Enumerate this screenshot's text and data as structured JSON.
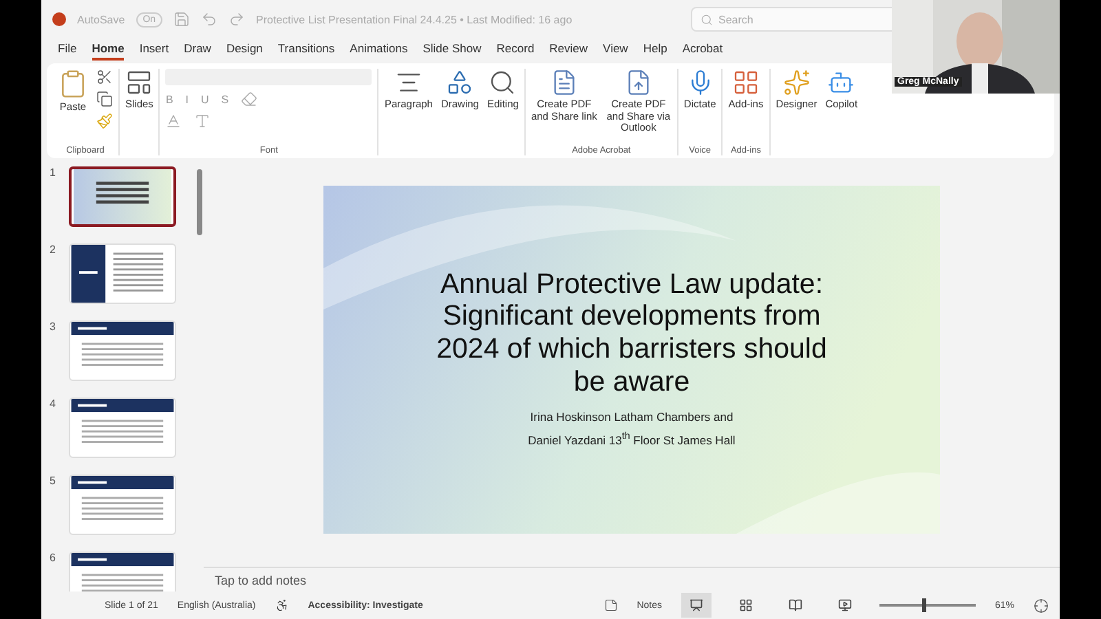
{
  "title_bar": {
    "autosave_label": "AutoSave",
    "autosave_toggle": "On",
    "document_title": "Protective List Presentation Final 24.4.25 • Last Modified: 16 ago",
    "search": {
      "placeholder": "Search"
    }
  },
  "tabs": [
    {
      "label": "File",
      "selected": false
    },
    {
      "label": "Home",
      "selected": true
    },
    {
      "label": "Insert",
      "selected": false
    },
    {
      "label": "Draw",
      "selected": false
    },
    {
      "label": "Design",
      "selected": false
    },
    {
      "label": "Transitions",
      "selected": false
    },
    {
      "label": "Animations",
      "selected": false
    },
    {
      "label": "Slide Show",
      "selected": false
    },
    {
      "label": "Record",
      "selected": false
    },
    {
      "label": "Review",
      "selected": false
    },
    {
      "label": "View",
      "selected": false
    },
    {
      "label": "Help",
      "selected": false
    },
    {
      "label": "Acrobat",
      "selected": false
    }
  ],
  "ribbon": {
    "clipboard": {
      "paste": "Paste",
      "group": "Clipboard"
    },
    "slides": {
      "label": "Slides"
    },
    "font": {
      "format_buttons": [
        "B",
        "I",
        "U",
        "S"
      ],
      "group": "Font"
    },
    "paragraph": "Paragraph",
    "drawing": "Drawing",
    "editing": "Editing",
    "acrobat": {
      "buttons": [
        "Create PDF and Share link",
        "Create PDF and Share via Outlook"
      ],
      "group": "Adobe Acrobat"
    },
    "voice": {
      "button": "Dictate",
      "group": "Voice"
    },
    "addins": {
      "button": "Add-ins",
      "group": "Add-ins"
    },
    "designer": "Designer",
    "copilot": "Copilot"
  },
  "video": {
    "name": "Greg McNally"
  },
  "slides": [
    {
      "number": "1",
      "kind": "title",
      "selected": true
    },
    {
      "number": "2",
      "kind": "split",
      "selected": false
    },
    {
      "number": "3",
      "kind": "banner",
      "selected": false
    },
    {
      "number": "4",
      "kind": "banner",
      "selected": false
    },
    {
      "number": "5",
      "kind": "banner",
      "selected": false
    },
    {
      "number": "6",
      "kind": "banner",
      "selected": false
    }
  ],
  "slide": {
    "title": "Annual Protective Law update: Significant developments from 2024 of which barristers should be aware",
    "subtitle": [
      "Irina Hoskinson Latham Chambers and",
      "Daniel Yazdani 13$^{th}$ Floor St James Hall"
    ]
  },
  "notes": {
    "placeholder": "Tap to add notes"
  },
  "status_bar": {
    "slide_count": "Slide 1 of 21",
    "language": "English (Australia)",
    "accessibility": "Accessibility: Investigate",
    "notes": "Notes",
    "views": [
      {
        "kind": "normal",
        "selected": true
      },
      {
        "kind": "sorter",
        "selected": false
      },
      {
        "kind": "reading",
        "selected": false
      },
      {
        "kind": "show",
        "selected": false
      }
    ],
    "zoom": {
      "level": 0.45,
      "reading": "61%"
    }
  }
}
